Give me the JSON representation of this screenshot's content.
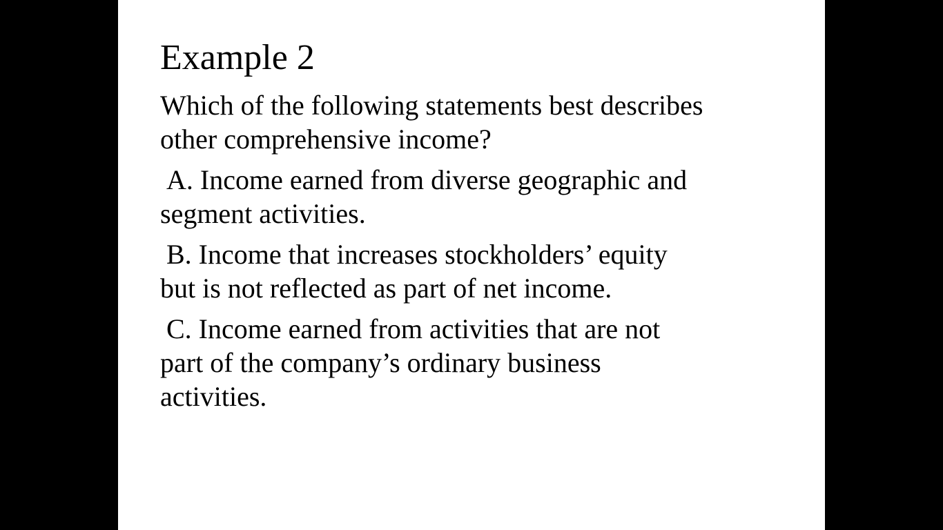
{
  "slide": {
    "title": "Example 2",
    "question": {
      "line1": "Which of the following statements best describes",
      "line2": "other comprehensive income?"
    },
    "options": [
      {
        "line1": "A. Income earned from diverse geographic and",
        "line2": "segment activities."
      },
      {
        "line1": "B. Income that increases stockholders’ equity",
        "line2": "but is not reflected as part of net income."
      },
      {
        "line1": "C. Income earned from activities that are not",
        "line2": "part of the company’s ordinary business",
        "line3": "activities."
      }
    ]
  },
  "colors": {
    "background": "#000000",
    "slide": "#ffffff",
    "text": "#000000"
  }
}
